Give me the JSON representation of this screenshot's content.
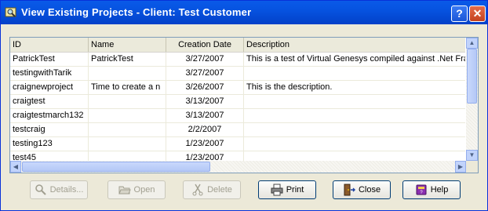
{
  "window": {
    "title": "View Existing Projects - Client:  Test Customer",
    "help_glyph": "?",
    "close_glyph": "✕"
  },
  "list": {
    "columns": [
      "ID",
      "Name",
      "Creation Date",
      "Description"
    ],
    "rows": [
      {
        "id": "PatrickTest",
        "name": "PatrickTest",
        "date": "3/27/2007",
        "description": "This is a test of Virtual Genesys compiled against .Net Fran"
      },
      {
        "id": "testingwithTarik",
        "name": "",
        "date": "3/27/2007",
        "description": ""
      },
      {
        "id": "craignewproject",
        "name": "Time to create a n",
        "date": "3/26/2007",
        "description": "This is the description."
      },
      {
        "id": "craigtest",
        "name": "",
        "date": "3/13/2007",
        "description": ""
      },
      {
        "id": "craigtestmarch132",
        "name": "",
        "date": "3/13/2007",
        "description": ""
      },
      {
        "id": "testcraig",
        "name": "",
        "date": "2/2/2007",
        "description": ""
      },
      {
        "id": "testing123",
        "name": "",
        "date": "1/23/2007",
        "description": ""
      },
      {
        "id": "test45",
        "name": "",
        "date": "1/23/2007",
        "description": ""
      }
    ]
  },
  "buttons": {
    "details": "Details...",
    "open": "Open",
    "delete": "Delete",
    "print": "Print",
    "close": "Close",
    "help": "Help"
  },
  "icons": {
    "title": "magnifier-window-icon",
    "details": "magnifier-icon",
    "open": "open-folder-icon",
    "delete": "scissors-icon",
    "print": "printer-icon",
    "close": "door-exit-icon",
    "help": "help-book-icon"
  },
  "colors": {
    "titlebar": "#0653e0",
    "accent_border": "#0831d9",
    "disabled_text": "#a19f90"
  }
}
